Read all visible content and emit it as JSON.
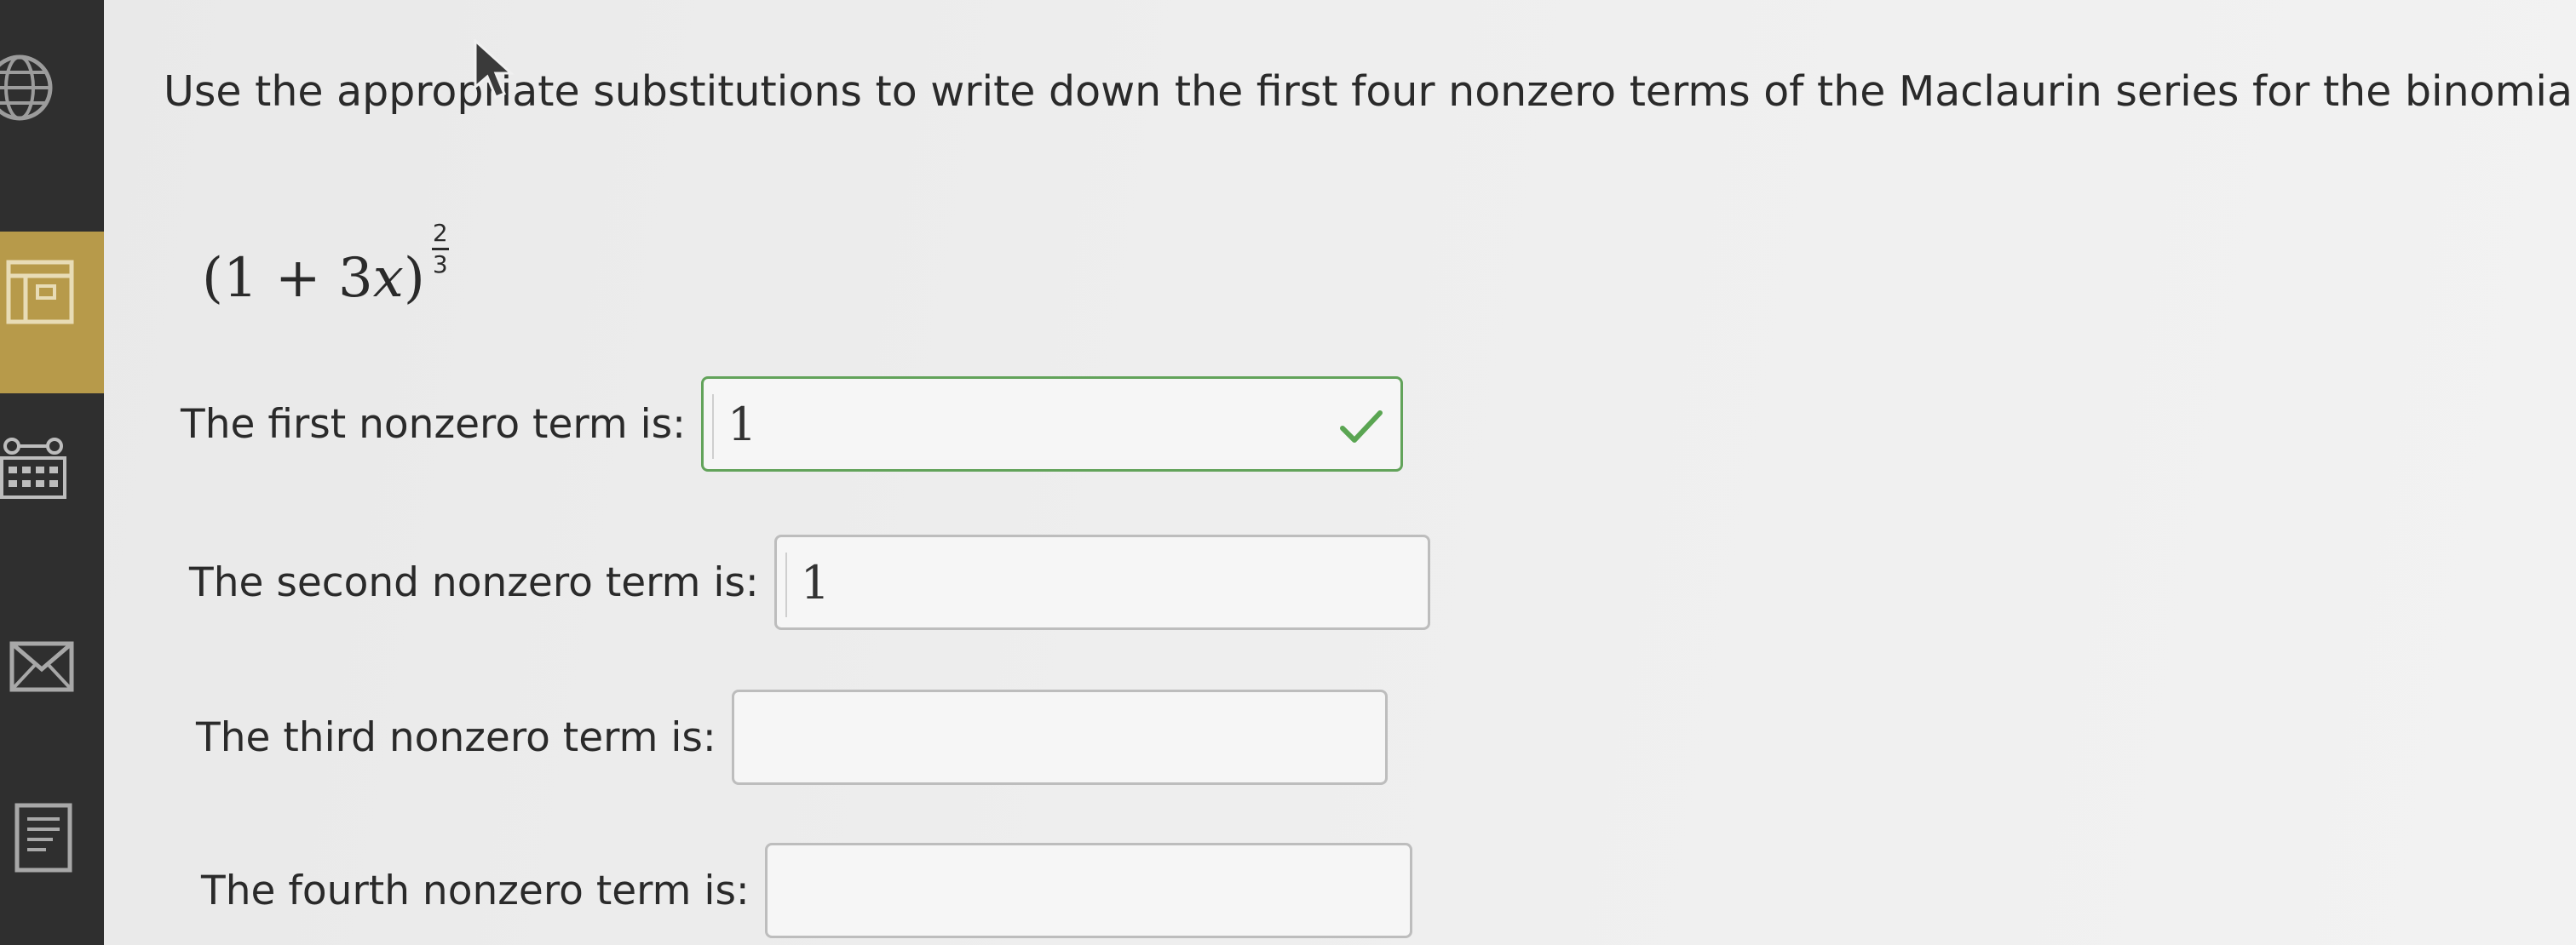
{
  "question": {
    "text": "Use the appropriate substitutions to write down the first four nonzero terms of the Maclaurin series for the binomial:"
  },
  "formula": {
    "open": "(1 + 3",
    "variable": "x",
    "close": ")",
    "exponent_numerator": "2",
    "exponent_denominator": "3"
  },
  "terms": [
    {
      "label": "The first nonzero term is:",
      "value": "1",
      "status": "correct"
    },
    {
      "label": "The second nonzero term is:",
      "value": "1",
      "status": "pending"
    },
    {
      "label": "The third nonzero term is:",
      "value": "",
      "status": "empty"
    },
    {
      "label": "The fourth nonzero term is:",
      "value": "",
      "status": "empty"
    }
  ],
  "sidebar": {
    "icons": [
      "globe-icon",
      "book-icon",
      "calendar-icon",
      "mail-icon",
      "notes-icon"
    ],
    "band_color": "#b79a4a"
  },
  "colors": {
    "correct_border": "#62a35a",
    "check": "#5aa552"
  }
}
